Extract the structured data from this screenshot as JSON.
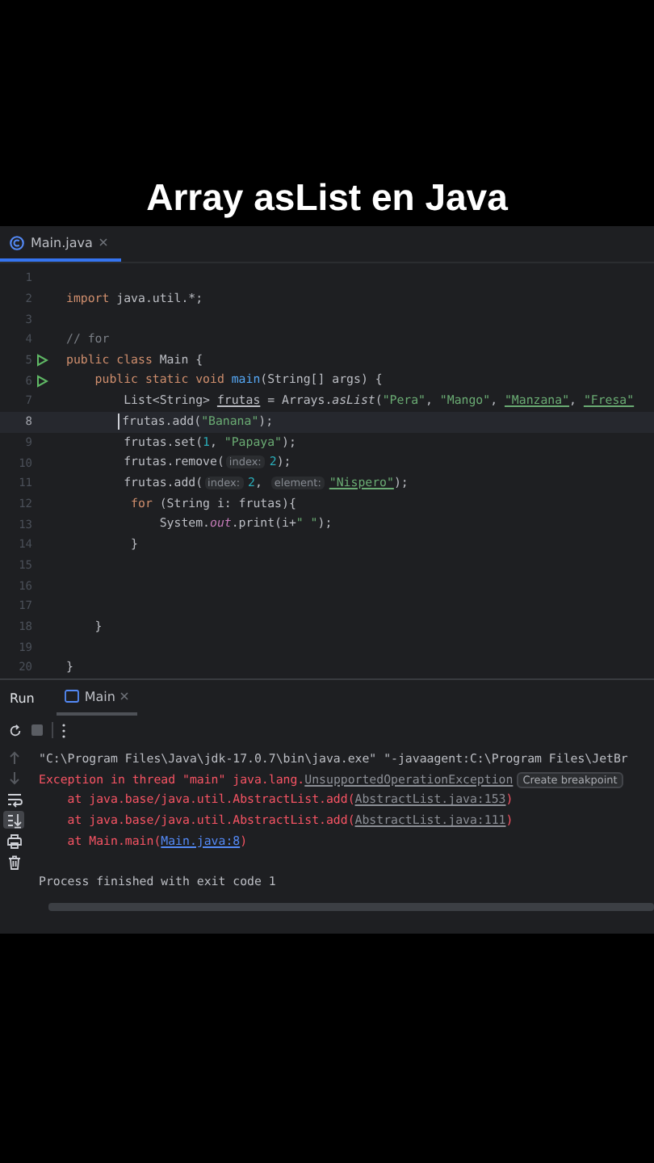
{
  "caption": "Array asList en Java",
  "editor_tabs": [
    {
      "label": "Main.java",
      "selected": true
    }
  ],
  "code_lines": [
    {
      "number": "1",
      "run": false,
      "current": false
    },
    {
      "number": "2",
      "run": false,
      "current": false,
      "segments": [
        {
          "kind": "kw",
          "text": "import "
        },
        {
          "kind": "p",
          "text": "java.util.*;"
        }
      ]
    },
    {
      "number": "3",
      "run": false,
      "current": false
    },
    {
      "number": "4",
      "run": false,
      "current": false,
      "segments": [
        {
          "kind": "cm",
          "text": "// for"
        }
      ]
    },
    {
      "number": "5",
      "run": true,
      "current": false,
      "segments": [
        {
          "kind": "kw",
          "text": "public class "
        },
        {
          "kind": "p",
          "text": "Main {"
        }
      ]
    },
    {
      "number": "6",
      "run": true,
      "current": false,
      "segments": [
        {
          "kind": "kw",
          "text": "    public static void "
        },
        {
          "kind": "fn",
          "text": "main"
        },
        {
          "kind": "p",
          "text": "(String[] args) {"
        }
      ]
    },
    {
      "number": "7",
      "run": false,
      "current": false,
      "segments": [
        {
          "kind": "p",
          "text": "        List<String> "
        },
        {
          "kind": "pu",
          "text": "frutas"
        },
        {
          "kind": "p",
          "text": " = Arrays."
        },
        {
          "kind": "it",
          "text": "asList"
        },
        {
          "kind": "p",
          "text": "("
        },
        {
          "kind": "str",
          "text": "\"Pera\""
        },
        {
          "kind": "p",
          "text": ", "
        },
        {
          "kind": "str",
          "text": "\"Mango\""
        },
        {
          "kind": "p",
          "text": ", "
        },
        {
          "kind": "stru",
          "text": "\"Manzana\""
        },
        {
          "kind": "p",
          "text": ", "
        },
        {
          "kind": "stru",
          "text": "\"Fresa\""
        }
      ]
    },
    {
      "number": "8",
      "run": false,
      "current": true,
      "segments": [
        {
          "kind": "p",
          "text": "        frutas.add("
        },
        {
          "kind": "str",
          "text": "\"Banana\""
        },
        {
          "kind": "p",
          "text": ");"
        }
      ]
    },
    {
      "number": "9",
      "run": false,
      "current": false,
      "segments": [
        {
          "kind": "p",
          "text": "        frutas.set("
        },
        {
          "kind": "num",
          "text": "1"
        },
        {
          "kind": "p",
          "text": ", "
        },
        {
          "kind": "str",
          "text": "\"Papaya\""
        },
        {
          "kind": "p",
          "text": ");"
        }
      ]
    },
    {
      "number": "10",
      "run": false,
      "current": false,
      "segments": [
        {
          "kind": "p",
          "text": "        frutas.remove("
        },
        {
          "kind": "hint",
          "text": "index:"
        },
        {
          "kind": "num",
          "text": "2"
        },
        {
          "kind": "p",
          "text": ");"
        }
      ]
    },
    {
      "number": "11",
      "run": false,
      "current": false,
      "segments": [
        {
          "kind": "p",
          "text": "        frutas.add("
        },
        {
          "kind": "hint",
          "text": "index:"
        },
        {
          "kind": "num",
          "text": "2"
        },
        {
          "kind": "p",
          "text": ", "
        },
        {
          "kind": "hint",
          "text": "element:"
        },
        {
          "kind": "stru",
          "text": "\"Nispero\""
        },
        {
          "kind": "p",
          "text": ");"
        }
      ]
    },
    {
      "number": "12",
      "run": false,
      "current": false,
      "segments": [
        {
          "kind": "kw",
          "text": "         for"
        },
        {
          "kind": "p",
          "text": " (String i: frutas){"
        }
      ]
    },
    {
      "number": "13",
      "run": false,
      "current": false,
      "segments": [
        {
          "kind": "p",
          "text": "             System."
        },
        {
          "kind": "fld",
          "text": "out"
        },
        {
          "kind": "p",
          "text": ".print(i+"
        },
        {
          "kind": "str",
          "text": "\" \""
        },
        {
          "kind": "p",
          "text": ");"
        }
      ]
    },
    {
      "number": "14",
      "run": false,
      "current": false,
      "segments": [
        {
          "kind": "p",
          "text": "         }"
        }
      ]
    },
    {
      "number": "15",
      "run": false,
      "current": false
    },
    {
      "number": "16",
      "run": false,
      "current": false
    },
    {
      "number": "17",
      "run": false,
      "current": false
    },
    {
      "number": "18",
      "run": false,
      "current": false,
      "segments": [
        {
          "kind": "p",
          "text": "    }"
        }
      ]
    },
    {
      "number": "19",
      "run": false,
      "current": false
    },
    {
      "number": "20",
      "run": false,
      "current": false,
      "segments": [
        {
          "kind": "p",
          "text": "}"
        }
      ]
    }
  ],
  "run_panel": {
    "title": "Run",
    "tabs": [
      {
        "label": "Main",
        "selected": true
      }
    ],
    "side_tools": [
      {
        "kind": "up",
        "selected": false
      },
      {
        "kind": "down",
        "selected": false
      },
      {
        "kind": "wrap",
        "selected": false
      },
      {
        "kind": "scroll_end",
        "selected": true
      },
      {
        "kind": "print",
        "selected": false
      },
      {
        "kind": "trash",
        "selected": false
      }
    ],
    "console_lines": [
      {
        "segments": [
          {
            "kind": "p",
            "text": "\"C:\\Program Files\\Java\\jdk-17.0.7\\bin\\java.exe\" \"-javaagent:C:\\Program Files\\JetBr"
          }
        ]
      },
      {
        "segments": [
          {
            "kind": "err",
            "text": "Exception in thread \"main\" java.lang."
          },
          {
            "kind": "link",
            "text": "UnsupportedOperationException"
          },
          {
            "kind": "tip",
            "text": "Create breakpoint"
          }
        ]
      },
      {
        "segments": [
          {
            "kind": "err",
            "text": "    at java.base/java.util.AbstractList.add("
          },
          {
            "kind": "link",
            "text": "AbstractList.java:153"
          },
          {
            "kind": "err",
            "text": ")"
          }
        ]
      },
      {
        "segments": [
          {
            "kind": "err",
            "text": "    at java.base/java.util.AbstractList.add("
          },
          {
            "kind": "link",
            "text": "AbstractList.java:111"
          },
          {
            "kind": "err",
            "text": ")"
          }
        ]
      },
      {
        "segments": [
          {
            "kind": "err",
            "text": "    at Main.main("
          },
          {
            "kind": "blue",
            "text": "Main.java:8"
          },
          {
            "kind": "err",
            "text": ")"
          }
        ]
      },
      {
        "segments": [
          {
            "kind": "p",
            "text": "Process finished with exit code 1"
          }
        ]
      }
    ]
  }
}
